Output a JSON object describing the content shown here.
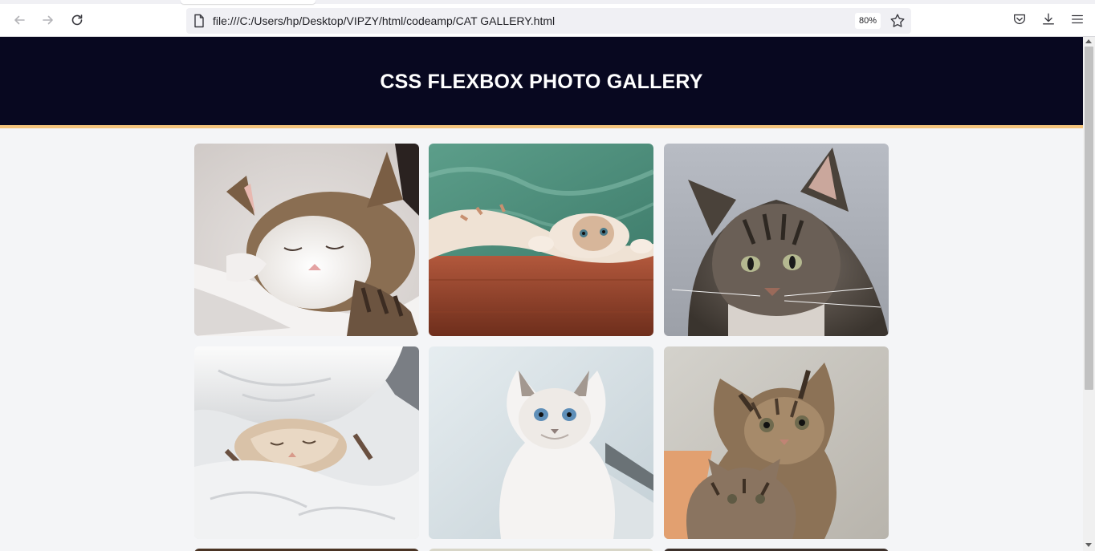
{
  "browser": {
    "url": "file:///C:/Users/hp/Desktop/VIPZY/html/codeamp/CAT GALLERY.html",
    "zoom": "80%",
    "icons": [
      "back-arrow-icon",
      "forward-arrow-icon",
      "reload-icon",
      "page-icon",
      "star-icon",
      "pocket-icon",
      "download-icon",
      "menu-icon"
    ]
  },
  "page": {
    "title": "CSS FLEXBOX PHOTO GALLERY",
    "colors": {
      "header_bg": "#080820",
      "header_border": "#f4c47c",
      "page_bg": "#f4f5f7"
    }
  },
  "gallery": {
    "photos": [
      {
        "subject": "sleeping tabby-and-white cat on white bedding"
      },
      {
        "subject": "fluffy kitten lying upside down on wooden floor"
      },
      {
        "subject": "tabby cat portrait with green eyes"
      },
      {
        "subject": "kitten sleeping under white duvet"
      },
      {
        "subject": "white kitten with blue eyes by window"
      },
      {
        "subject": "two tabby kittens"
      }
    ]
  }
}
